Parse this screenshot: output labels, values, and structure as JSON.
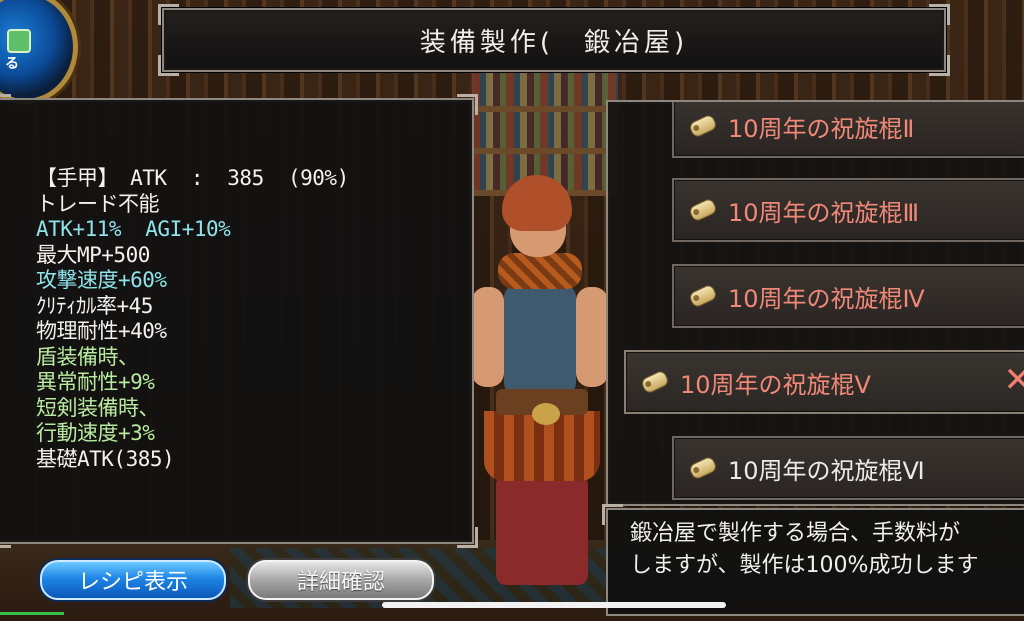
{
  "title": "装備製作(　鍛冶屋)",
  "menu_button": {
    "label": "る"
  },
  "item_stats": [
    {
      "text": "【手甲】 ATK  :  385  (90%)",
      "color": "white"
    },
    {
      "text": "トレード不能",
      "color": "white"
    },
    {
      "text": "ATK+11%  AGI+10%",
      "color": "cyan"
    },
    {
      "text": "最大MP+500",
      "color": "white"
    },
    {
      "text": "攻撃速度+60%",
      "color": "cyan"
    },
    {
      "text": "ｸﾘﾃｨｶﾙ率+45",
      "color": "white"
    },
    {
      "text": "物理耐性+40%",
      "color": "white"
    },
    {
      "text": "盾装備時、",
      "color": "green"
    },
    {
      "text": "異常耐性+9%",
      "color": "green"
    },
    {
      "text": "短剣装備時、",
      "color": "green"
    },
    {
      "text": "行動速度+3%",
      "color": "green"
    },
    {
      "text": "基礎ATK(385)",
      "color": "white"
    }
  ],
  "recipes": [
    {
      "label": "10周年の祝旋棍Ⅱ",
      "color": "red",
      "selected": false
    },
    {
      "label": "10周年の祝旋棍Ⅲ",
      "color": "red",
      "selected": false
    },
    {
      "label": "10周年の祝旋棍Ⅳ",
      "color": "red",
      "selected": false
    },
    {
      "label": "10周年の祝旋棍Ⅴ",
      "color": "red",
      "selected": true
    },
    {
      "label": "10周年の祝旋棍Ⅵ",
      "color": "white",
      "selected": false
    }
  ],
  "close_label": "✕",
  "description": "鍛冶屋で製作する場合、手数料が\nしますが、製作は100%成功します",
  "buttons": {
    "recipe": "レシピ表示",
    "detail": "詳細確認"
  },
  "colors": {
    "red_text": "#f08878",
    "cyan_text": "#8fe3ea",
    "green_text": "#b8eaa0",
    "blue_button": "#1f86e6"
  }
}
